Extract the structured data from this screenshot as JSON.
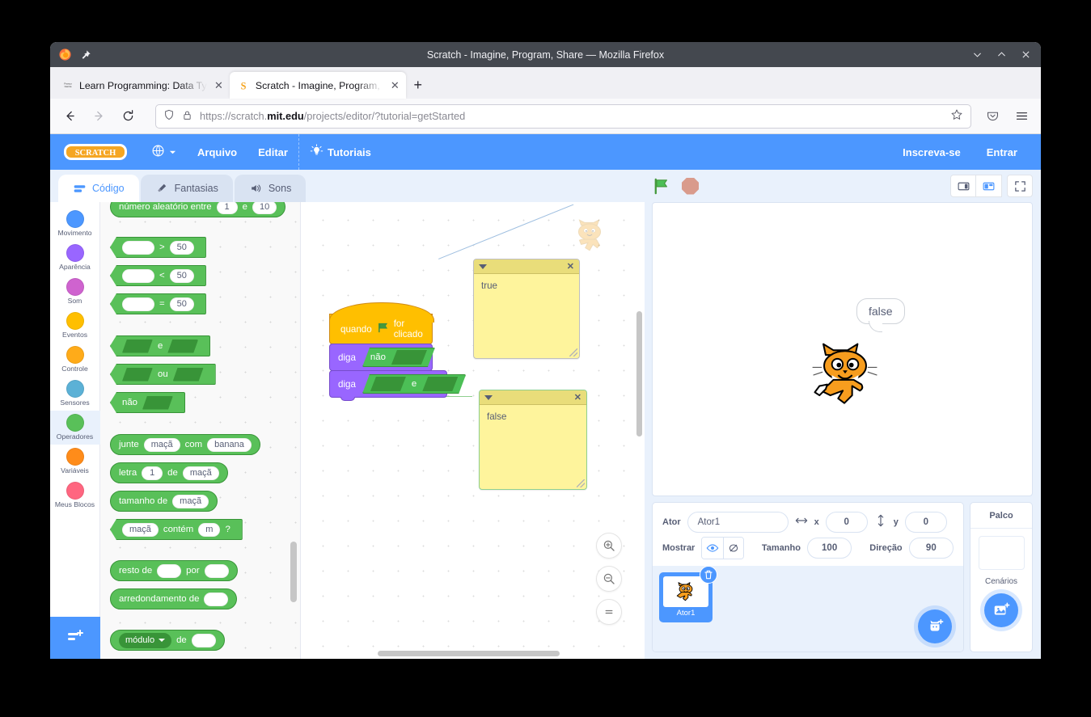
{
  "window": {
    "title": "Scratch - Imagine, Program, Share — Mozilla Firefox",
    "minimize": "⌄",
    "maximize": "⌃",
    "close": "✕"
  },
  "tabs": [
    {
      "label": "Learn Programming: Data Typ",
      "favicon": "franco-garcia-icon",
      "close": "✕",
      "active": false
    },
    {
      "label": "Scratch - Imagine, Program, S",
      "favicon": "scratch-favicon",
      "close": "✕",
      "active": true
    }
  ],
  "newtab_label": "+",
  "nav": {
    "back": "←",
    "forward": "→",
    "reload": "⟳",
    "url_scheme": "https://",
    "url_domain_pre": "scratch.",
    "url_domain_bold": "mit.edu",
    "url_path": "/projects/editor/?tutorial=getStarted",
    "bookmark_icon": "star-icon",
    "pocket_icon": "pocket-icon",
    "menu_icon": "hamburger-icon"
  },
  "menubar": {
    "logo": "SCRATCH",
    "language": "globe-icon",
    "items": [
      "Arquivo",
      "Editar"
    ],
    "tutorials": "Tutoriais",
    "join": "Inscreva-se",
    "signin": "Entrar"
  },
  "editor_tabs": [
    {
      "label": "Código",
      "icon": "code-icon",
      "active": true
    },
    {
      "label": "Fantasias",
      "icon": "brush-icon",
      "active": false
    },
    {
      "label": "Sons",
      "icon": "speaker-icon",
      "active": false
    }
  ],
  "categories": [
    {
      "label": "Movimento",
      "color": "#4c97ff"
    },
    {
      "label": "Aparência",
      "color": "#9966ff"
    },
    {
      "label": "Som",
      "color": "#cf63cf"
    },
    {
      "label": "Eventos",
      "color": "#ffbf00"
    },
    {
      "label": "Controle",
      "color": "#ffab19"
    },
    {
      "label": "Sensores",
      "color": "#5cb1d6"
    },
    {
      "label": "Operadores",
      "color": "#59c059",
      "selected": true
    },
    {
      "label": "Variáveis",
      "color": "#ff8c1a"
    },
    {
      "label": "Meus Blocos",
      "color": "#ff6680"
    }
  ],
  "add_extension": "add-extension-icon",
  "palette_blocks": {
    "random": {
      "pre": "número aleatório entre",
      "v1": "1",
      "mid": "e",
      "v2": "10"
    },
    "gt": {
      "op": ">",
      "val": "50"
    },
    "lt": {
      "op": "<",
      "val": "50"
    },
    "eq": {
      "op": "=",
      "val": "50"
    },
    "and": "e",
    "or": "ou",
    "not": "não",
    "join": {
      "pre": "junte",
      "v1": "maçã",
      "mid": "com",
      "v2": "banana"
    },
    "letter": {
      "pre": "letra",
      "v1": "1",
      "mid": "de",
      "v2": "maçã"
    },
    "length": {
      "pre": "tamanho de",
      "v1": "maçã"
    },
    "contains": {
      "v1": "maçã",
      "mid": "contém",
      "v2": "m",
      "post": "?"
    },
    "mod": {
      "pre": "resto de",
      "mid": "por"
    },
    "round": {
      "pre": "arredondamento de"
    },
    "mathop": {
      "sel": "módulo",
      "mid": "de"
    }
  },
  "script": {
    "hat": {
      "pre": "quando",
      "flag": "green-flag-icon",
      "post": "for clicado"
    },
    "say1": {
      "label": "diga",
      "operator": "não"
    },
    "say2": {
      "label": "diga",
      "operator": "e"
    }
  },
  "comments": [
    {
      "text": "true",
      "collapse": "collapse-triangle",
      "close": "✕"
    },
    {
      "text": "false",
      "collapse": "collapse-triangle",
      "close": "✕"
    }
  ],
  "canvas_controls": {
    "zoom_in": "zoom-in-icon",
    "zoom_out": "zoom-out-icon",
    "zoom_reset": "zoom-reset-icon"
  },
  "stage": {
    "green_flag": "green-flag-icon",
    "stop": "stop-icon",
    "mode_small": "small-stage-icon",
    "mode_large": "large-stage-icon",
    "mode_full": "fullscreen-icon",
    "bubble_text": "false",
    "sprite_image": "scratch-cat"
  },
  "sprite_panel": {
    "name_label": "Ator",
    "name_value": "Ator1",
    "x_label": "x",
    "x_value": "0",
    "y_label": "y",
    "y_value": "0",
    "show_label": "Mostrar",
    "show_on": "eye-icon",
    "show_off": "eye-slash-icon",
    "size_label": "Tamanho",
    "size_value": "100",
    "direction_label": "Direção",
    "direction_value": "90",
    "sprite_card_name": "Ator1",
    "delete_icon": "trash-icon",
    "add_sprite_icon": "add-sprite-cat-icon"
  },
  "stage_panel": {
    "title": "Palco",
    "backdrops_label": "Cenários",
    "add_backdrop_icon": "add-backdrop-icon"
  }
}
